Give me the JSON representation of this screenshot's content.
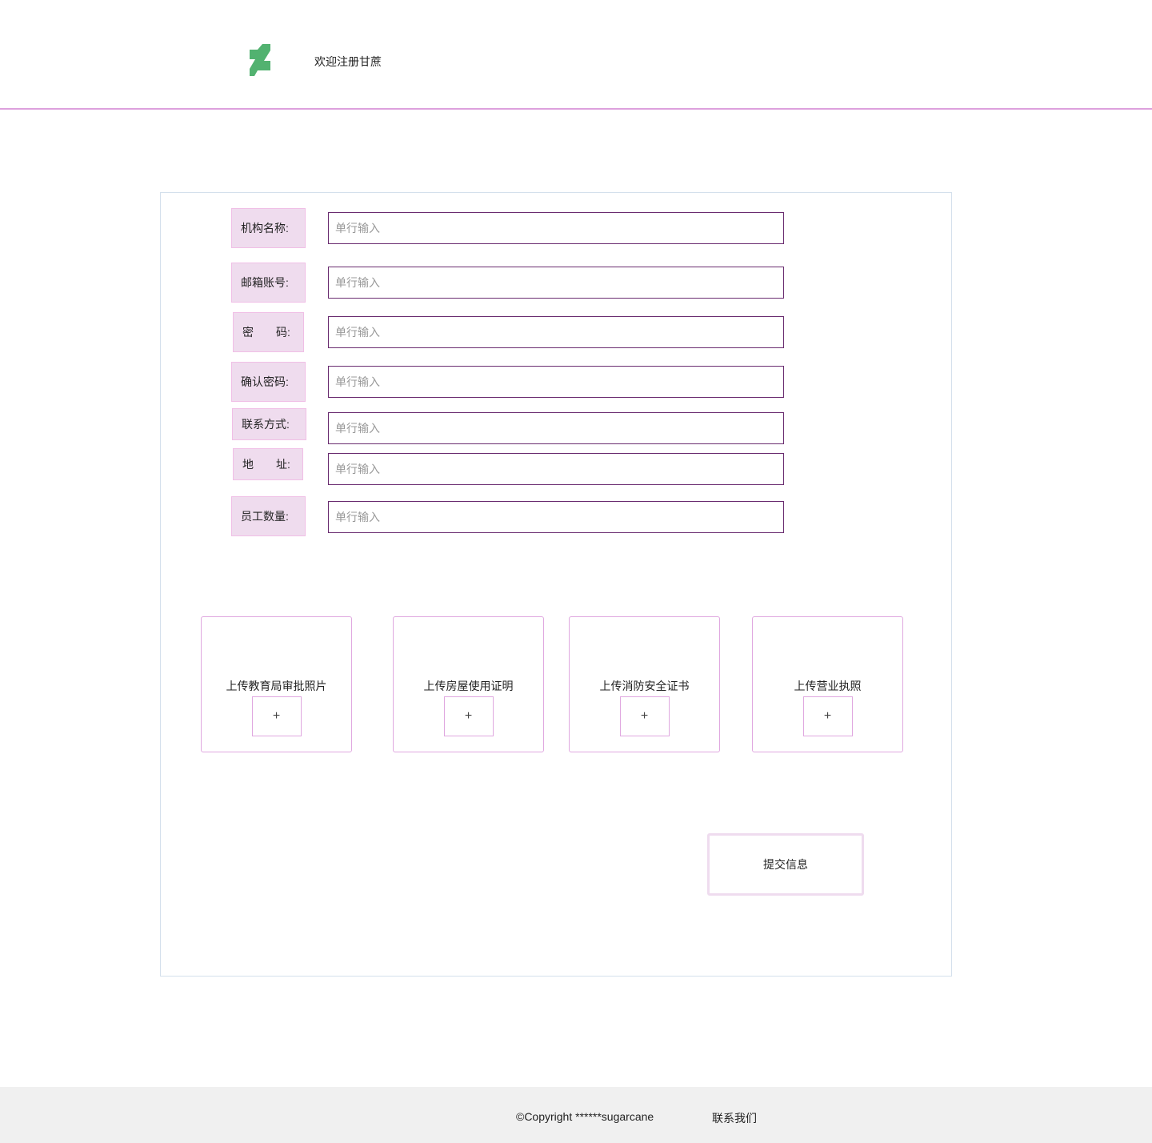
{
  "header": {
    "title": "欢迎注册甘蔗",
    "logo_color": "#52b270"
  },
  "form": {
    "placeholder": "单行输入",
    "fields": [
      {
        "label": "机构名称:"
      },
      {
        "label": "邮箱账号:"
      },
      {
        "label": "密　　码:"
      },
      {
        "label": "确认密码:"
      },
      {
        "label": "联系方式:"
      },
      {
        "label": "地　　址:"
      },
      {
        "label": "员工数量:"
      }
    ]
  },
  "uploads": [
    {
      "label": "上传教育局审批照片",
      "button": "+"
    },
    {
      "label": "上传房屋使用证明",
      "button": "+"
    },
    {
      "label": "上传消防安全证书",
      "button": "+"
    },
    {
      "label": "上传营业执照",
      "button": "+"
    }
  ],
  "submit_label": "提交信息",
  "footer": {
    "copyright": "©Copyright ******sugarcane",
    "contact": "联系我们"
  }
}
